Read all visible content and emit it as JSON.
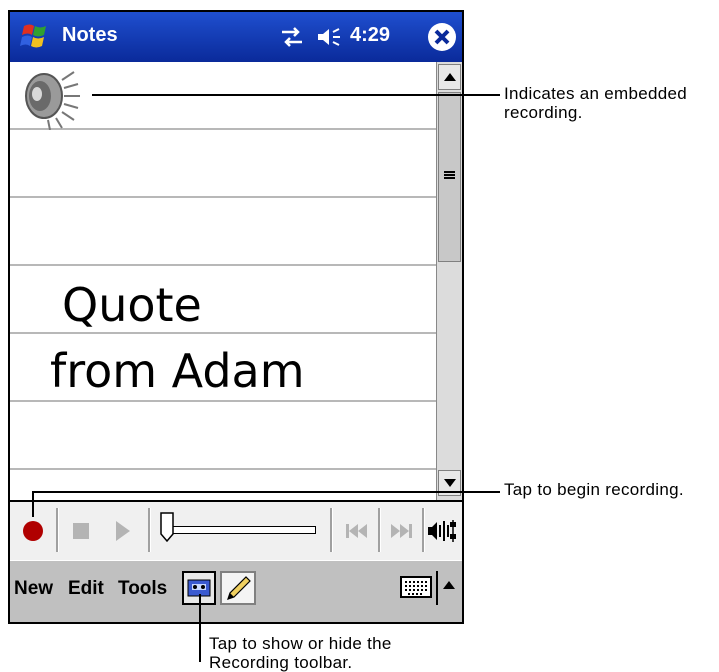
{
  "app": {
    "title": "Notes",
    "clock": "4:29"
  },
  "note": {
    "ink_lines": [
      "Quote",
      "from Adam"
    ]
  },
  "recording_toolbar": {
    "buttons": [
      "record",
      "stop",
      "play",
      "volume-slider",
      "rewind",
      "fast-forward",
      "recording-options"
    ]
  },
  "menu": {
    "new": "New",
    "edit": "Edit",
    "tools": "Tools"
  },
  "callouts": {
    "embedded_recording": "Indicates an embedded recording.",
    "begin_recording": "Tap to begin recording.",
    "toggle_toolbar": "Tap to show or hide the Recording toolbar."
  },
  "icons": {
    "start": "windows-flag-icon",
    "sync": "sync-arrows-icon",
    "volume": "speaker-icon",
    "close": "close-icon",
    "recording": "speaker-recording-icon",
    "keyboard": "keyboard-icon",
    "pen": "pen-icon"
  },
  "colors": {
    "titlebar": "#1f4fcf",
    "record": "#b00000"
  }
}
